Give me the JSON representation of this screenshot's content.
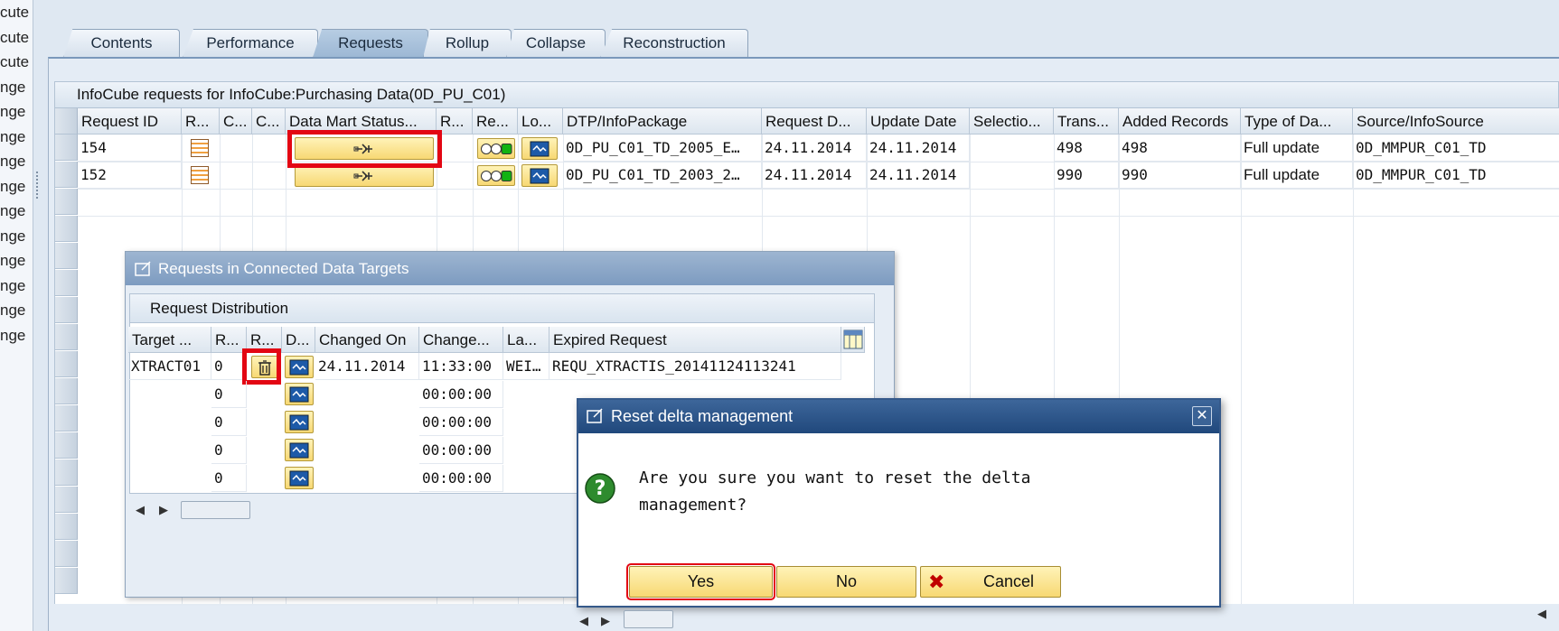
{
  "left_strip": [
    "cute",
    "cute",
    "cute",
    "nge",
    "nge",
    "nge",
    "nge",
    "nge",
    "nge",
    "nge",
    "nge",
    "nge",
    "nge",
    "nge"
  ],
  "tabs": [
    {
      "label": "Contents",
      "active": false
    },
    {
      "label": "Performance",
      "active": false
    },
    {
      "label": "Requests",
      "active": true
    },
    {
      "label": "Rollup",
      "active": false
    },
    {
      "label": "Collapse",
      "active": false
    },
    {
      "label": "Reconstruction",
      "active": false
    }
  ],
  "grid": {
    "title": "InfoCube requests for InfoCube:Purchasing Data(0D_PU_C01)",
    "columns": [
      "Request ID",
      "R...",
      "C...",
      "C...",
      "Data Mart Status...",
      "R...",
      "Re...",
      "Lo...",
      "DTP/InfoPackage",
      "Request D...",
      "Update Date",
      "Selectio...",
      "Trans...",
      "Added Records",
      "Type of Da...",
      "Source/InfoSource"
    ],
    "rows": [
      {
        "request_id": "154",
        "dtp": "0D_PU_C01_TD_2005_E…",
        "request_date": "24.11.2014",
        "update_date": "24.11.2014",
        "trans": "498",
        "added": "498",
        "type": "Full update",
        "source": "0D_MMPUR_C01_TD"
      },
      {
        "request_id": "152",
        "dtp": "0D_PU_C01_TD_2003_2…",
        "request_date": "24.11.2014",
        "update_date": "24.11.2014",
        "trans": "990",
        "added": "990",
        "type": "Full update",
        "source": "0D_MMPUR_C01_TD"
      }
    ]
  },
  "sub_dialog": {
    "title": "Requests in Connected Data Targets",
    "section_title": "Request Distribution",
    "columns": [
      "Target ...",
      "R...",
      "R...",
      "D...",
      "Changed On",
      "Change...",
      "La...",
      "Expired Request"
    ],
    "rows": [
      {
        "target": "XTRACT01",
        "r": "0",
        "changed_on": "24.11.2014",
        "change_time": "11:33:00",
        "la": "WEI…",
        "expired": "REQU_XTRACTIS_20141124113241"
      },
      {
        "target": "",
        "r": "0",
        "changed_on": "",
        "change_time": "00:00:00",
        "la": "",
        "expired": ""
      },
      {
        "target": "",
        "r": "0",
        "changed_on": "",
        "change_time": "00:00:00",
        "la": "",
        "expired": ""
      },
      {
        "target": "",
        "r": "0",
        "changed_on": "",
        "change_time": "00:00:00",
        "la": "",
        "expired": ""
      },
      {
        "target": "",
        "r": "0",
        "changed_on": "",
        "change_time": "00:00:00",
        "la": "",
        "expired": ""
      }
    ]
  },
  "modal": {
    "title": "Reset delta management",
    "message_line1": "Are you sure you want to reset the delta",
    "message_line2": "management?",
    "yes_label": "Yes",
    "no_label": "No",
    "cancel_label": "Cancel"
  },
  "colors": {
    "highlight": "#e30613",
    "button_yellow": "#f7d873",
    "title_blue": "#20487c"
  }
}
